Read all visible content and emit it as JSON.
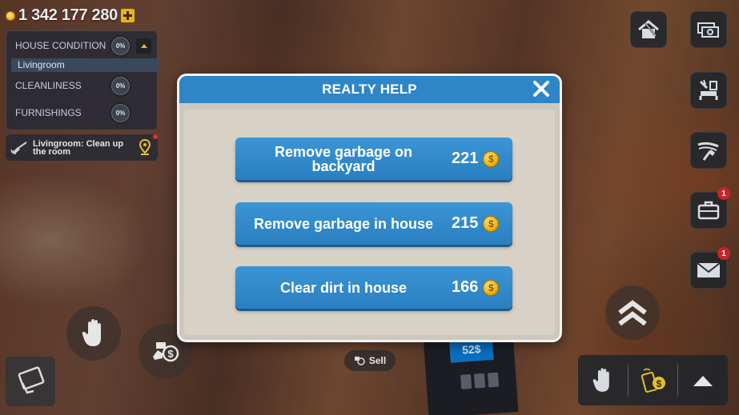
{
  "hud": {
    "money": "1 342 177 280",
    "status": {
      "house_condition_label": "HOUSE CONDITION",
      "house_condition_value": "0%",
      "room_name": "Livingroom",
      "cleanliness_label": "CLEANLINESS",
      "cleanliness_value": "0%",
      "furnishings_label": "FURNISHINGS",
      "furnishings_value": "0%"
    },
    "task": "Livingroom: Clean up the room",
    "side_buttons": [
      {
        "icon": "realty-house-icon"
      },
      {
        "icon": "money-icon"
      },
      {
        "icon": "furniture-icon"
      },
      {
        "icon": "paint-icon"
      },
      {
        "icon": "briefcase-icon",
        "badge": "1"
      },
      {
        "icon": "mail-icon",
        "badge": "1"
      }
    ],
    "sell_label": "Sell",
    "device_screen": "52$"
  },
  "modal": {
    "title": "REALTY HELP",
    "options": [
      {
        "label": "Remove garbage on backyard",
        "price": "221"
      },
      {
        "label": "Remove garbage in house",
        "price": "215"
      },
      {
        "label": "Clear dirt in house",
        "price": "166"
      }
    ],
    "coin_symbol": "$"
  },
  "colors": {
    "modal_header": "#2e86c6",
    "option_button": "#2f87c8",
    "coin": "#f2b10c",
    "badge": "#c8232c"
  }
}
